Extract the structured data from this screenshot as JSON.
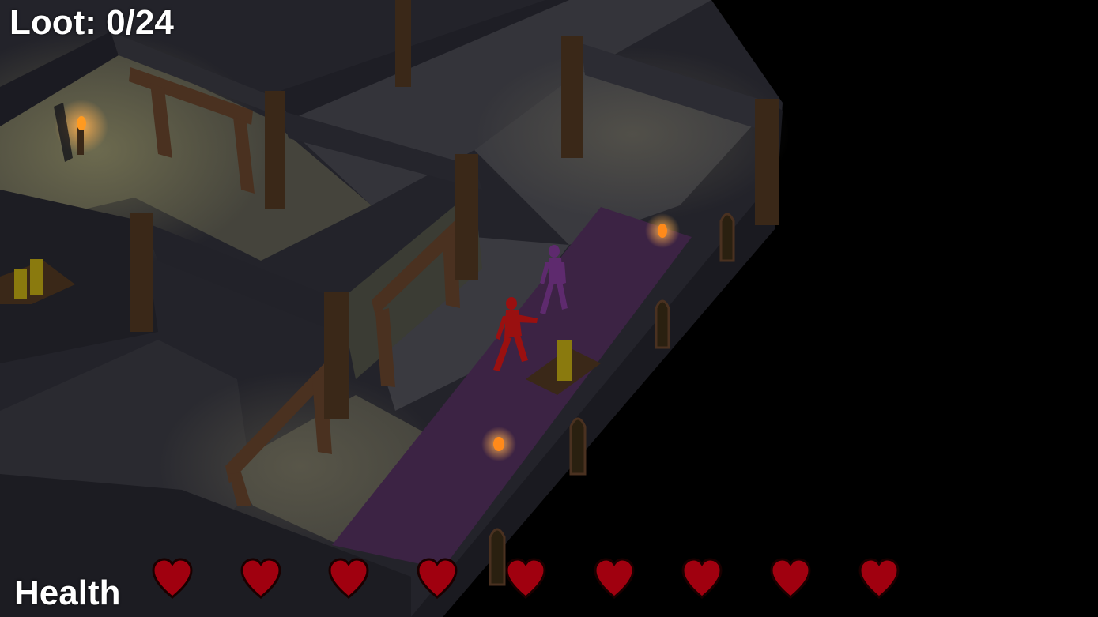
{
  "hud": {
    "loot_label": "Loot: 0/24",
    "health_label": "Health",
    "hearts_total": 9,
    "hearts_full": 9,
    "heart_color": "#a0000f"
  },
  "scene": {
    "floor_color": "#3a3a40",
    "wall_color": "#1f1f26",
    "beam_color": "#4a3120",
    "carpet_color": "#3c2344",
    "torch_color": "#ff8a1a",
    "player_color": "#9a1010",
    "enemy_color": "#5e2a6e",
    "loot_color": "#9a8a10"
  }
}
